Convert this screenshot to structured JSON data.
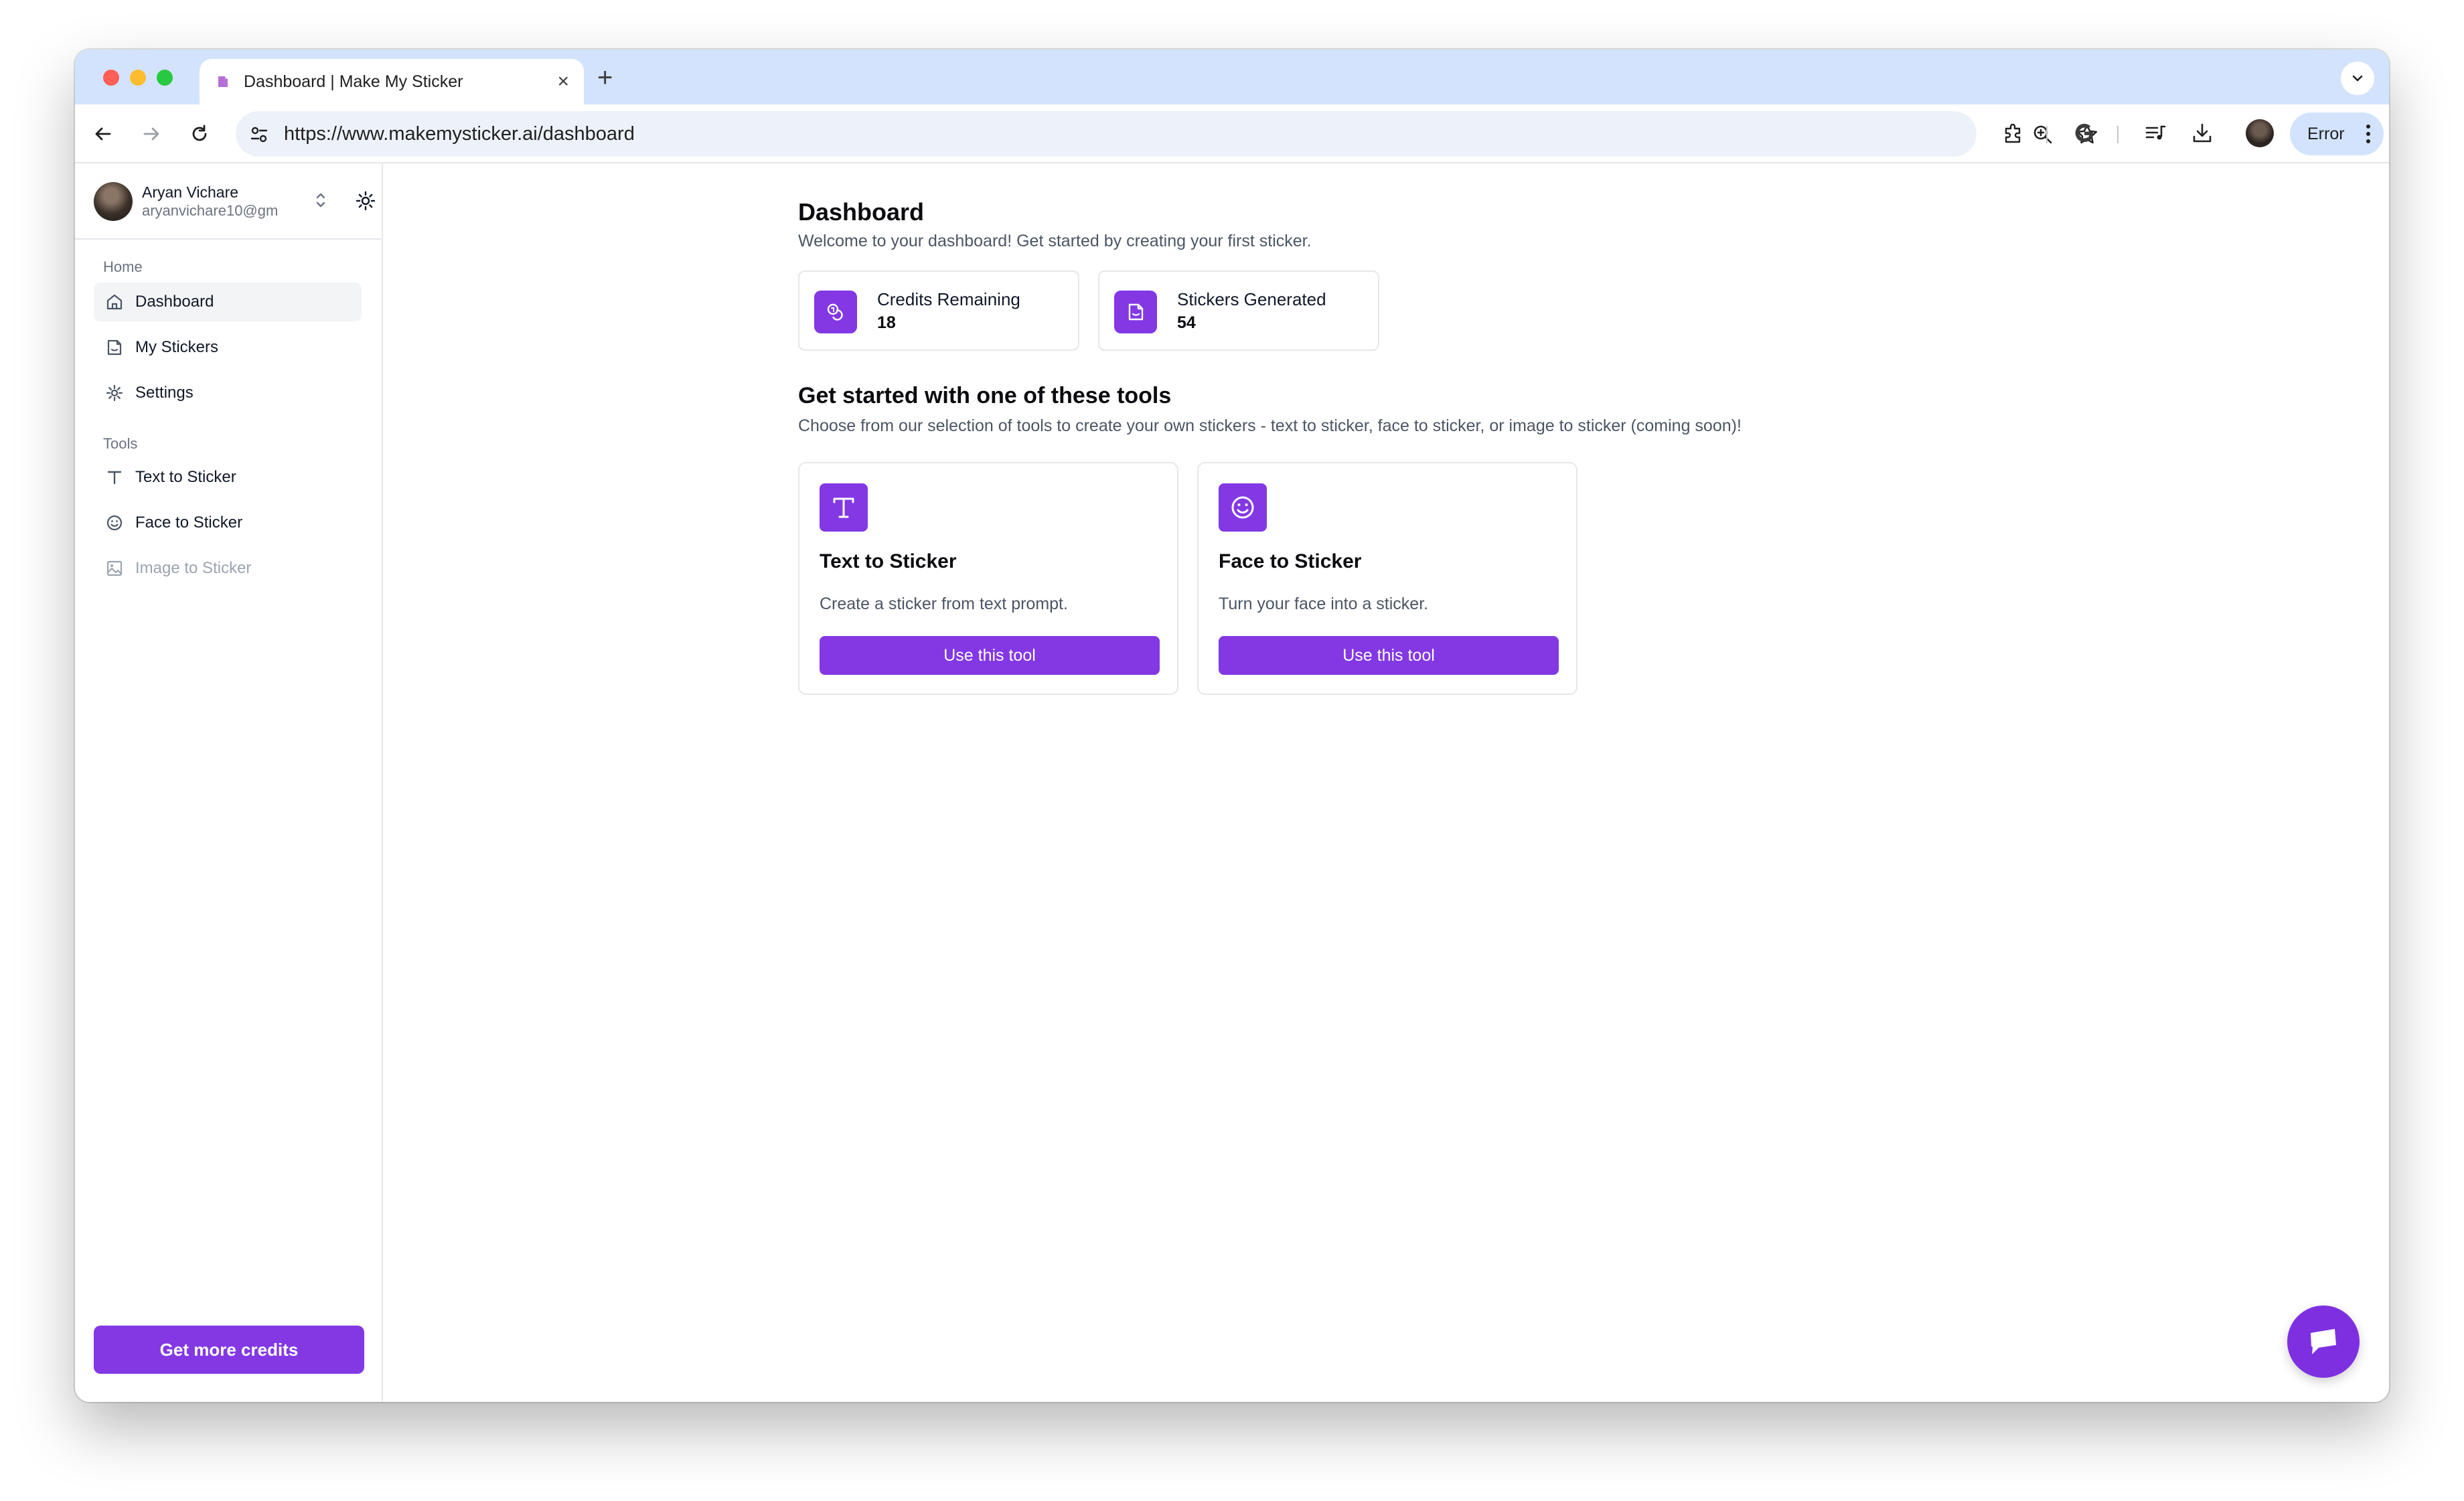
{
  "browser": {
    "tab_title": "Dashboard | Make My Sticker",
    "url": "https://www.makemysticker.ai/dashboard",
    "error_label": "Error"
  },
  "user": {
    "name": "Aryan Vichare",
    "email": "aryanvichare10@gm"
  },
  "sidebar": {
    "home_label": "Home",
    "home_items": [
      {
        "label": "Dashboard",
        "icon": "home-icon"
      },
      {
        "label": "My Stickers",
        "icon": "sticker-icon"
      },
      {
        "label": "Settings",
        "icon": "gear-icon"
      }
    ],
    "tools_label": "Tools",
    "tool_items": [
      {
        "label": "Text to Sticker",
        "icon": "text-icon"
      },
      {
        "label": "Face to Sticker",
        "icon": "smile-icon"
      },
      {
        "label": "Image to Sticker",
        "icon": "image-icon"
      }
    ],
    "credits_button": "Get more credits"
  },
  "dashboard": {
    "title": "Dashboard",
    "subtitle": "Welcome to your dashboard! Get started by creating your first sticker.",
    "stats": [
      {
        "label": "Credits Remaining",
        "value": "18"
      },
      {
        "label": "Stickers Generated",
        "value": "54"
      }
    ],
    "tools_title": "Get started with one of these tools",
    "tools_subtitle": "Choose from our selection of tools to create your own stickers - text to sticker, face to sticker, or image to sticker (coming soon)!",
    "tools": [
      {
        "name": "Text to Sticker",
        "description": "Create a sticker from text prompt.",
        "button": "Use this tool"
      },
      {
        "name": "Face to Sticker",
        "description": "Turn your face into a sticker.",
        "button": "Use this tool"
      }
    ]
  },
  "colors": {
    "accent": "#8338e4",
    "tab_strip": "#d3e3fd"
  }
}
